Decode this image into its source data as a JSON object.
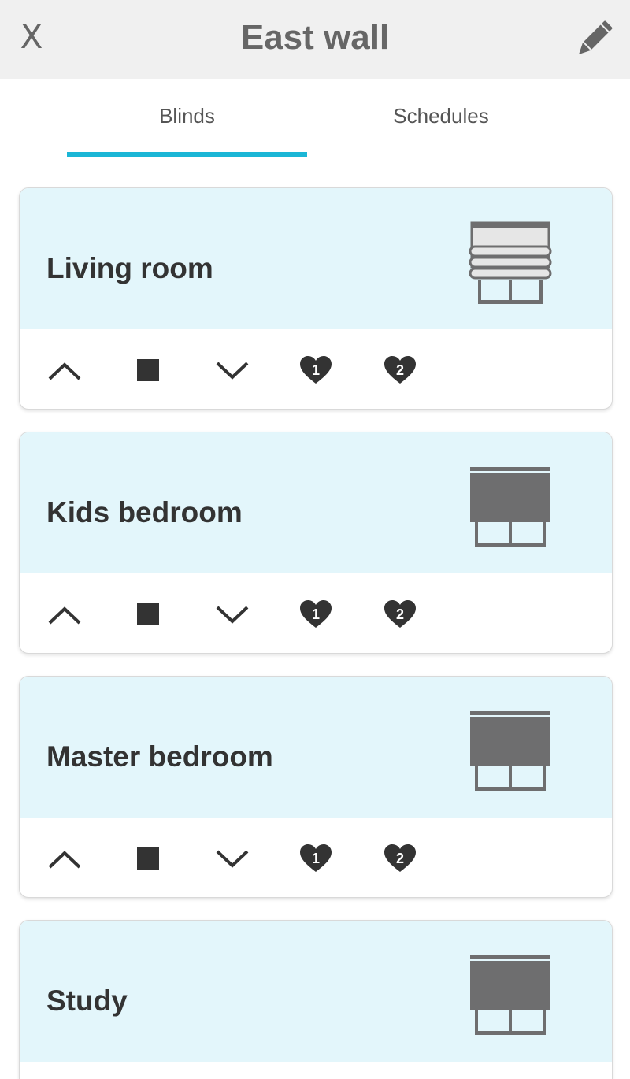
{
  "header": {
    "close_label": "X",
    "title": "East wall",
    "edit_icon": "pencil-icon"
  },
  "tabs": [
    {
      "label": "Blinds",
      "active": true
    },
    {
      "label": "Schedules",
      "active": false
    }
  ],
  "colors": {
    "accent": "#1bb6d6",
    "card_header_bg": "#e3f6fb",
    "icon_dark": "#333333",
    "blind_gray": "#6e6e6f",
    "topbar_bg": "#f0f0f0"
  },
  "blinds": [
    {
      "name": "Living room",
      "state": "open",
      "icon": "blind-open-icon"
    },
    {
      "name": "Kids bedroom",
      "state": "closed",
      "icon": "blind-closed-icon"
    },
    {
      "name": "Master bedroom",
      "state": "closed",
      "icon": "blind-closed-icon"
    },
    {
      "name": "Study",
      "state": "closed",
      "icon": "blind-closed-icon"
    }
  ],
  "controls": {
    "up_icon": "chevron-up-icon",
    "stop_icon": "stop-icon",
    "down_icon": "chevron-down-icon",
    "favorite_1_label": "1",
    "favorite_2_label": "2"
  }
}
